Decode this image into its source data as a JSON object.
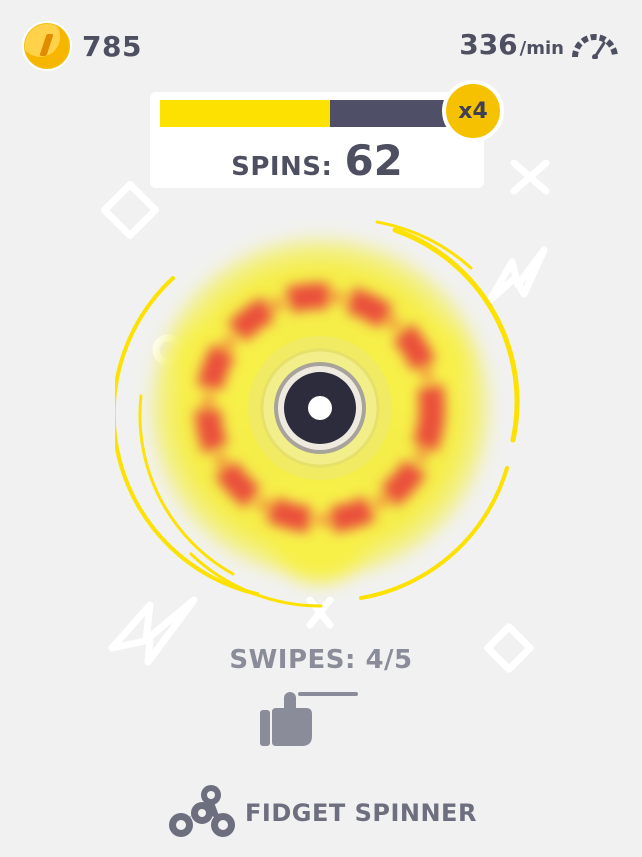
{
  "hud": {
    "coins": "785",
    "speed_value": "336",
    "speed_unit": "/min"
  },
  "spins_panel": {
    "progress": 0.59,
    "label": "SPINS:",
    "value": "62",
    "multiplier": "x4"
  },
  "instructions": {
    "swipes_text": "SWIPES: 4/5"
  },
  "branding": {
    "title": "FIDGET SPINNER"
  },
  "colors": {
    "background": "#f1f1f1",
    "accent_yellow": "#fde100",
    "dark": "#4f5068",
    "spinner_red": "#e84c3d"
  },
  "icons": {
    "coin": "coin-icon",
    "speed": "speedometer-icon",
    "hand": "swipe-hand-icon",
    "logo": "fidget-spinner-logo-icon"
  }
}
